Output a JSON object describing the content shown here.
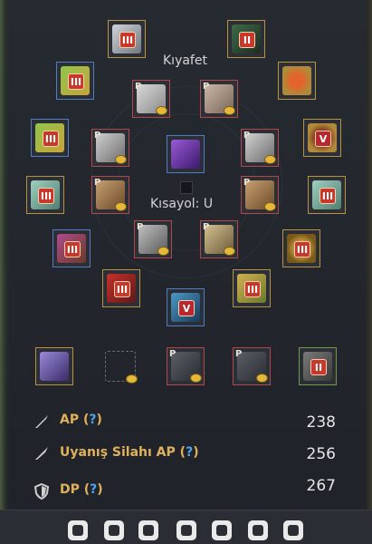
{
  "equipment": {
    "outfit_label": "Kıyafet",
    "shortcut_label": "Kısayol: U",
    "enhance": {
      "III": "III",
      "II": "II",
      "V": "V",
      "P": "P"
    }
  },
  "stats": [
    {
      "name": "AP",
      "help": "?",
      "value": "238",
      "icon": "sword-icon"
    },
    {
      "name": "Uyanış Silahı AP",
      "help": "?",
      "value": "256",
      "icon": "awakening-sword-icon"
    },
    {
      "name": "DP",
      "help": "?",
      "value": "267",
      "icon": "shield-icon"
    }
  ],
  "colors": {
    "slot_gold": "#b79245",
    "slot_blue": "#4f7cc3",
    "slot_red": "#b1474a",
    "slot_green": "#6f9a47",
    "stat_label": "#e0b15b",
    "help_mark": "#4ea4e8"
  },
  "toolbar_icons": [
    "horse-icon",
    "mask-icon",
    "cat-face-icon",
    "paw-icon",
    "dog-icon",
    "pet-icon",
    "person-icon"
  ]
}
